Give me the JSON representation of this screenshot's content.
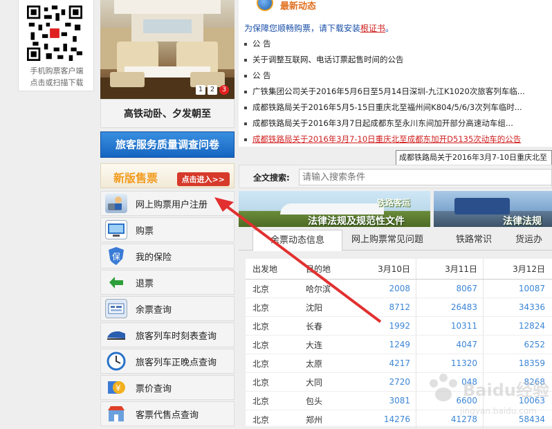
{
  "qr": {
    "caption_line1": "手机购票客户端",
    "caption_line2": "点击或扫描下载"
  },
  "sidebar": {
    "photo_caption": "高铁动卧、夕发朝至",
    "slides": [
      "1",
      "2",
      "3"
    ],
    "survey_banner": "旅客服务质量调查问卷",
    "new_ticket_title": "新版售票",
    "enter_button": "点击进入>>",
    "menu": [
      {
        "label": "网上购票用户注册",
        "icon": "user-register-icon"
      },
      {
        "label": "购票",
        "icon": "computer-ticket-icon"
      },
      {
        "label": "我的保险",
        "icon": "insurance-shield-icon"
      },
      {
        "label": "退票",
        "icon": "refund-arrow-icon"
      },
      {
        "label": "余票查询",
        "icon": "remaining-tickets-icon"
      },
      {
        "label": "旅客列车时刻表查询",
        "icon": "train-icon"
      },
      {
        "label": "旅客列车正晚点查询",
        "icon": "clock-icon"
      },
      {
        "label": "票价查询",
        "icon": "price-yuan-icon"
      },
      {
        "label": "客票代售点查询",
        "icon": "shop-icon"
      }
    ]
  },
  "news": {
    "title": "最新动态",
    "cert_notice": "为保障您顺畅购票，请下载安装",
    "cert_link": "根证书",
    "cert_end": "。",
    "items": [
      "公 告",
      "关于调整互联网、电话订票起售时间的公告",
      "公 告",
      "广铁集团公司关于2016年5月6日至5月14日深圳-九江K1020次旅客列车临...",
      "成都铁路局关于2016年5月5-15日重庆北至福州间K804/5/6/3次列车临时...",
      "成都铁路局关于2016年3月7日起成都东至永川东间加开部分高速动车组...",
      "成都铁路局关于2016年3月7-10日重庆北至成都东加开D5135次动车的公告"
    ],
    "tooltip": "成都铁路局关于2016年3月7-10日重庆北至"
  },
  "search": {
    "label": "全文搜索:",
    "placeholder": "请输入搜索条件"
  },
  "banners": {
    "banner1_sub": "铁路客运",
    "banner1_main": "法律法规及规范性文件",
    "banner2_main": "法律法规"
  },
  "tabs": [
    "余票动态信息",
    "网上购票常见问题",
    "铁路常识",
    "货运办"
  ],
  "table": {
    "headers": [
      "出发地",
      "目的地",
      "3月10日",
      "3月11日",
      "3月12日"
    ],
    "rows": [
      [
        "北京",
        "哈尔滨",
        "2008",
        "8067",
        "10087"
      ],
      [
        "北京",
        "沈阳",
        "8712",
        "26483",
        "34336"
      ],
      [
        "北京",
        "长春",
        "1992",
        "10311",
        "12824"
      ],
      [
        "北京",
        "大连",
        "1249",
        "4047",
        "6252"
      ],
      [
        "北京",
        "太原",
        "4217",
        "11320",
        "18359"
      ],
      [
        "北京",
        "大同",
        "2720",
        "048",
        "8268"
      ],
      [
        "北京",
        "包头",
        "3081",
        "6600",
        "10063"
      ],
      [
        "北京",
        "郑州",
        "14276",
        "41278",
        "58434"
      ]
    ]
  },
  "watermark": {
    "text": "Baidu经验",
    "sub": "jingyan.baidu.com"
  },
  "colors": {
    "accent_red": "#d02020",
    "link_blue": "#3b86d6",
    "survey_blue": "#1565c0",
    "arrow_red": "#e23030"
  }
}
